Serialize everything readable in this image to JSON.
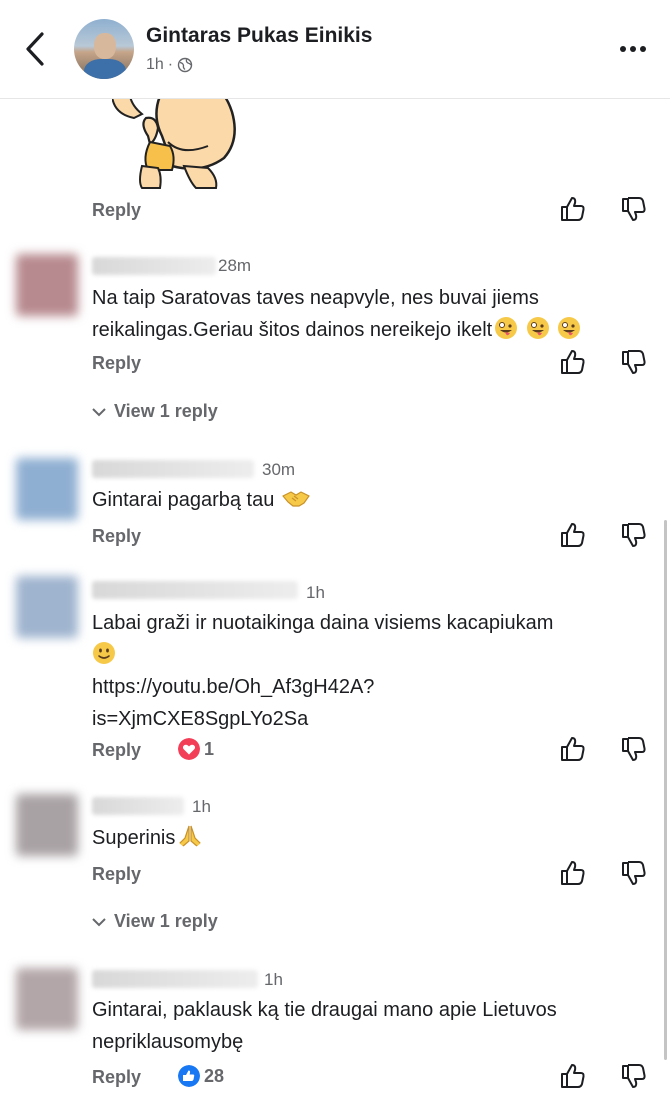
{
  "header": {
    "name": "Gintaras Pukas Einikis",
    "time": "1h",
    "time_sep": "·"
  },
  "labels": {
    "reply": "Reply"
  },
  "comments": [
    {
      "time": "28m",
      "text": "Na taip Saratovas taves neapvyle, nes buvai jiems reikalingas.Geriau šitos dainos nereikejo ikelt",
      "view_replies": "View 1 reply"
    },
    {
      "time": "30m",
      "text": "Gintarai pagarbą tau"
    },
    {
      "time": "1h",
      "text_line1": "Labai graži ir nuotaikinga daina visiems kacapiukam",
      "link_line1": "https://youtu.be/Oh_Af3gH42A?",
      "link_line2": "is=XjmCXE8SgpLYo2Sa",
      "reaction_count": "1"
    },
    {
      "time": "1h",
      "text": "Superinis",
      "view_replies": "View 1 reply"
    },
    {
      "time": "1h",
      "text": "Gintarai, paklausk ką tie draugai mano apie Lietuvos nepriklausomybę",
      "reaction_count": "28"
    }
  ],
  "colors": {
    "text": "#1c1e21",
    "muted": "#65676b",
    "like_blue": "#1877f2",
    "love_red": "#f33e58"
  },
  "icons": [
    "back-arrow-icon",
    "more-options-icon",
    "globe-icon",
    "thumbs-up-icon",
    "thumbs-down-icon",
    "chevron-down-icon",
    "love-reaction-icon",
    "like-reaction-icon"
  ]
}
